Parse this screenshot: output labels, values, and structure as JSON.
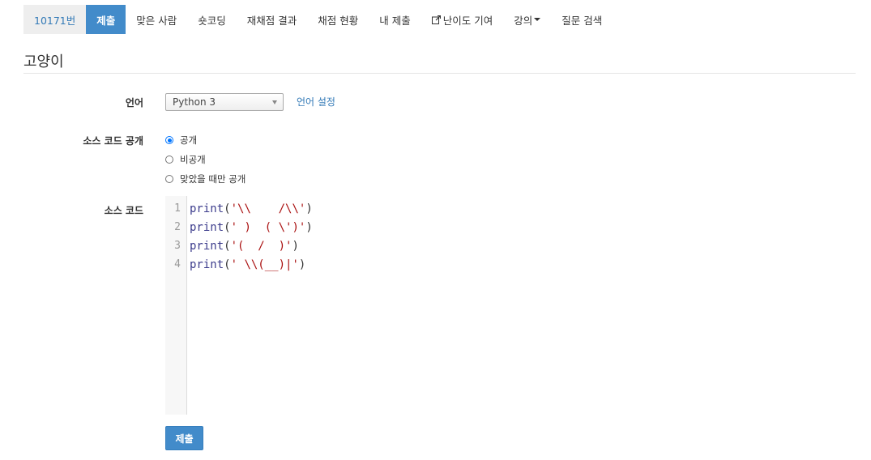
{
  "nav": {
    "problem_id": "10171번",
    "items": [
      {
        "label": "제출",
        "active": true
      },
      {
        "label": "맞은 사람"
      },
      {
        "label": "숏코딩"
      },
      {
        "label": "재채점 결과"
      },
      {
        "label": "채점 현황"
      },
      {
        "label": "내 제출"
      },
      {
        "label": "난이도 기여",
        "icon": "external-link-icon"
      },
      {
        "label": "강의",
        "dropdown": true
      },
      {
        "label": "질문 검색"
      }
    ]
  },
  "page": {
    "title": "고양이"
  },
  "form": {
    "language_label": "언어",
    "language_selected": "Python 3",
    "language_settings_link": "언어 설정",
    "visibility_label": "소스 코드 공개",
    "visibility_options": [
      {
        "label": "공개",
        "checked": true
      },
      {
        "label": "비공개",
        "checked": false
      },
      {
        "label": "맞았을 때만 공개",
        "checked": false
      }
    ],
    "source_label": "소스 코드",
    "code_lines": [
      {
        "num": "1",
        "fn": "print",
        "open": "(",
        "str": "'\\\\    /\\\\'",
        "close": ")"
      },
      {
        "num": "2",
        "fn": "print",
        "open": "(",
        "str": "' )  ( \\')'",
        "close": ")"
      },
      {
        "num": "3",
        "fn": "print",
        "open": "(",
        "str": "'(  /  )'",
        "close": ")"
      },
      {
        "num": "4",
        "fn": "print",
        "open": "(",
        "str": "' \\\\(__)|'",
        "close": ")"
      }
    ],
    "submit_label": "제출"
  },
  "colors": {
    "primary": "#428bca",
    "link": "#337ab7",
    "string": "#aa1111",
    "keyword": "#3c3c8c"
  }
}
